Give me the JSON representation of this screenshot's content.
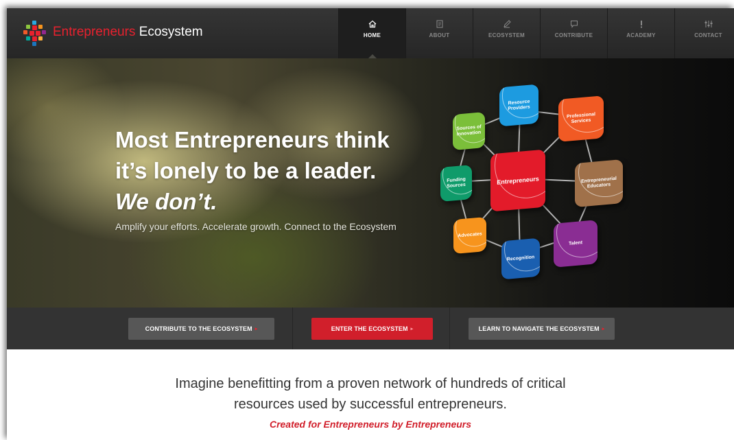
{
  "brand": {
    "name_red": "Entrepreneurs",
    "name_white": "Ecosystem"
  },
  "nav": {
    "items": [
      {
        "label": "HOME",
        "icon": "home-icon"
      },
      {
        "label": "ABOUT",
        "icon": "document-icon"
      },
      {
        "label": "ECOSYSTEM",
        "icon": "pencil-icon"
      },
      {
        "label": "CONTRIBUTE",
        "icon": "speech-bubble-icon"
      },
      {
        "label": "ACADEMY",
        "icon": "exclamation-icon"
      },
      {
        "label": "CONTACT",
        "icon": "sliders-icon"
      }
    ],
    "active": "HOME"
  },
  "hero": {
    "line1": "Most Entrepreneurs think",
    "line2": "it’s lonely to be a leader.",
    "line3": "We don’t.",
    "subtitle": "Amplify your efforts. Accelerate growth. Connect to the Ecosystem",
    "diagram": {
      "center": "Entrepreneurs",
      "nodes": [
        "Resource Providers",
        "Professional Services",
        "Entrepreneurial Educators",
        "Talent",
        "Recognition",
        "Advocates",
        "Funding Sources",
        "Sources of Innovation"
      ]
    }
  },
  "buttons": {
    "contribute": "CONTRIBUTE TO THE ECOSYSTEM",
    "enter": "ENTER THE ECOSYSTEM",
    "learn": "LEARN TO NAVIGATE THE ECOSYSTEM"
  },
  "intro": {
    "line1": "Imagine benefitting from a proven network of hundreds of critical",
    "line2": "resources used by successful entrepreneurs.",
    "tagline": "Created for Entrepreneurs by Entrepreneurs"
  },
  "colors": {
    "brand_red": "#e8212e",
    "nav_bg": "#2e2e2e",
    "button_red": "#d11f2b",
    "button_grey": "#575757"
  }
}
